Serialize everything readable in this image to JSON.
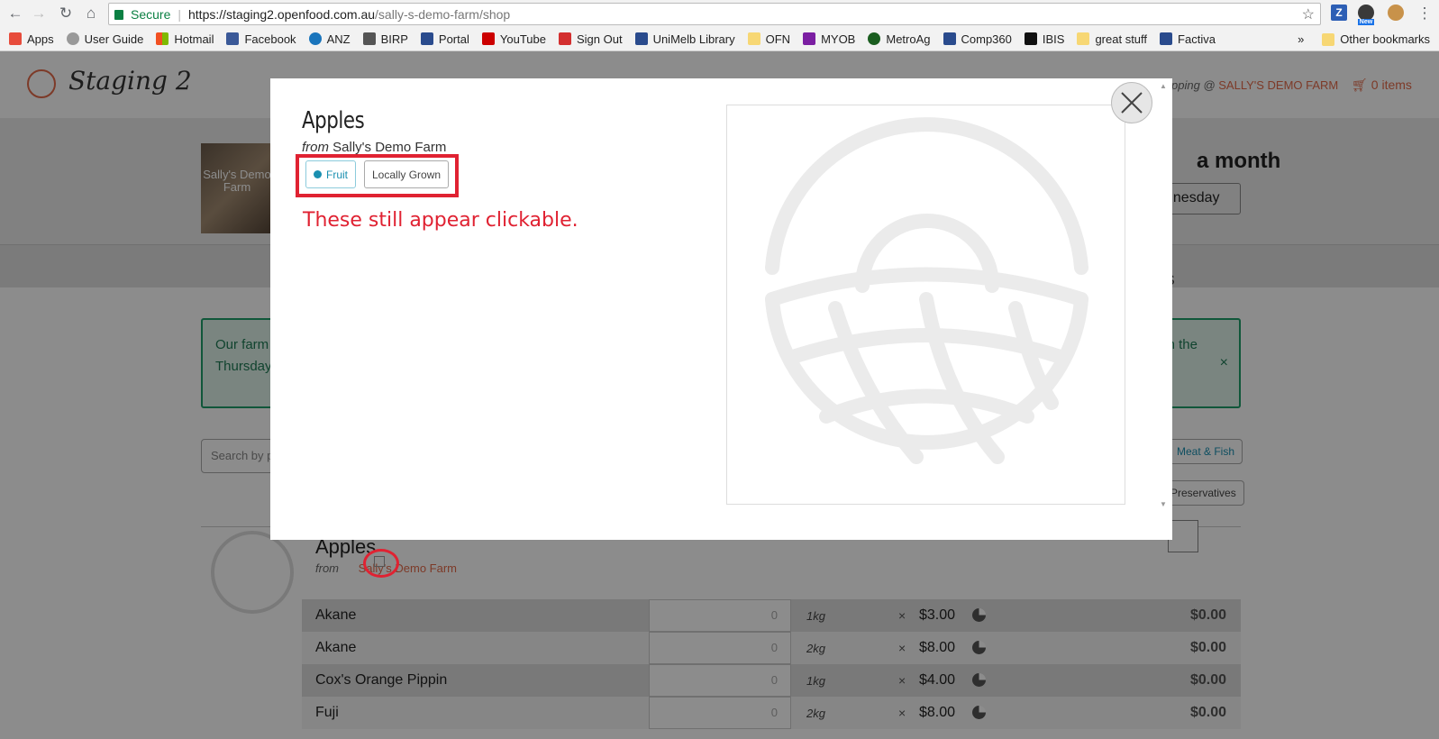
{
  "browser": {
    "secure_label": "Secure",
    "url_host": "https://staging2.openfood.com.au",
    "url_path": "/sally-s-demo-farm/shop",
    "ext_new_badge": "New"
  },
  "bookmarks": [
    {
      "label": "Apps",
      "color": "#e74c3c"
    },
    {
      "label": "User Guide",
      "color": "#999999"
    },
    {
      "label": "Hotmail",
      "color": "#f25022"
    },
    {
      "label": "Facebook",
      "color": "#3b5998"
    },
    {
      "label": "ANZ",
      "color": "#1a75bc"
    },
    {
      "label": "BIRP",
      "color": "#555555"
    },
    {
      "label": "Portal",
      "color": "#2a4b8d"
    },
    {
      "label": "YouTube",
      "color": "#cc0000"
    },
    {
      "label": "Sign Out",
      "color": "#d32f2f"
    },
    {
      "label": "UniMelb Library",
      "color": "#2a4b8d"
    },
    {
      "label": "OFN",
      "color": "#f7d774"
    },
    {
      "label": "MYOB",
      "color": "#7b1fa2"
    },
    {
      "label": "MetroAg",
      "color": "#1b5e20"
    },
    {
      "label": "Comp360",
      "color": "#2a4b8d"
    },
    {
      "label": "IBIS",
      "color": "#111111"
    },
    {
      "label": "great stuff",
      "color": "#f7d774"
    },
    {
      "label": "Factiva",
      "color": "#2a4b8d"
    }
  ],
  "bookmarks_more": "»",
  "other_bookmarks": "Other bookmarks",
  "site": {
    "logo_text": "Staging 2",
    "shopping_prefix": "pping @",
    "shop_name": "SALLY'S DEMO FARM",
    "cart_label": "0 items",
    "farm_img_text": "Sally's Demo Farm",
    "hero_title": "a month",
    "hero_select": "dnesday",
    "tabs_partial": "S",
    "notice_left": "Our farm",
    "notice_left2": "Thursday",
    "notice_right": "n the",
    "notice_close": "×",
    "search_placeholder": "Search by pr",
    "filter_meat": "Meat & Fish",
    "filter_preservatives": "Preservatives"
  },
  "product": {
    "name": "Apples",
    "from_prefix": "from",
    "producer": "Sally's Demo Farm",
    "variants": [
      {
        "name": "Akane",
        "qty": "0",
        "unit": "1kg",
        "price": "$3.00",
        "total": "$0.00"
      },
      {
        "name": "Akane",
        "qty": "0",
        "unit": "2kg",
        "price": "$8.00",
        "total": "$0.00"
      },
      {
        "name": "Cox's Orange Pippin",
        "qty": "0",
        "unit": "1kg",
        "price": "$4.00",
        "total": "$0.00"
      },
      {
        "name": "Fuji",
        "qty": "0",
        "unit": "2kg",
        "price": "$8.00",
        "total": "$0.00"
      }
    ],
    "times": "×"
  },
  "modal": {
    "title": "Apples",
    "from_prefix": "from",
    "producer": "Sally's Demo Farm",
    "tags": [
      "Fruit",
      "Locally Grown"
    ],
    "annotation": "These still appear clickable.",
    "close_label": "×"
  },
  "colors": {
    "annotation_red": "#e02232",
    "brand": "#e36b4a",
    "tag_blue": "#1a8fb0"
  }
}
